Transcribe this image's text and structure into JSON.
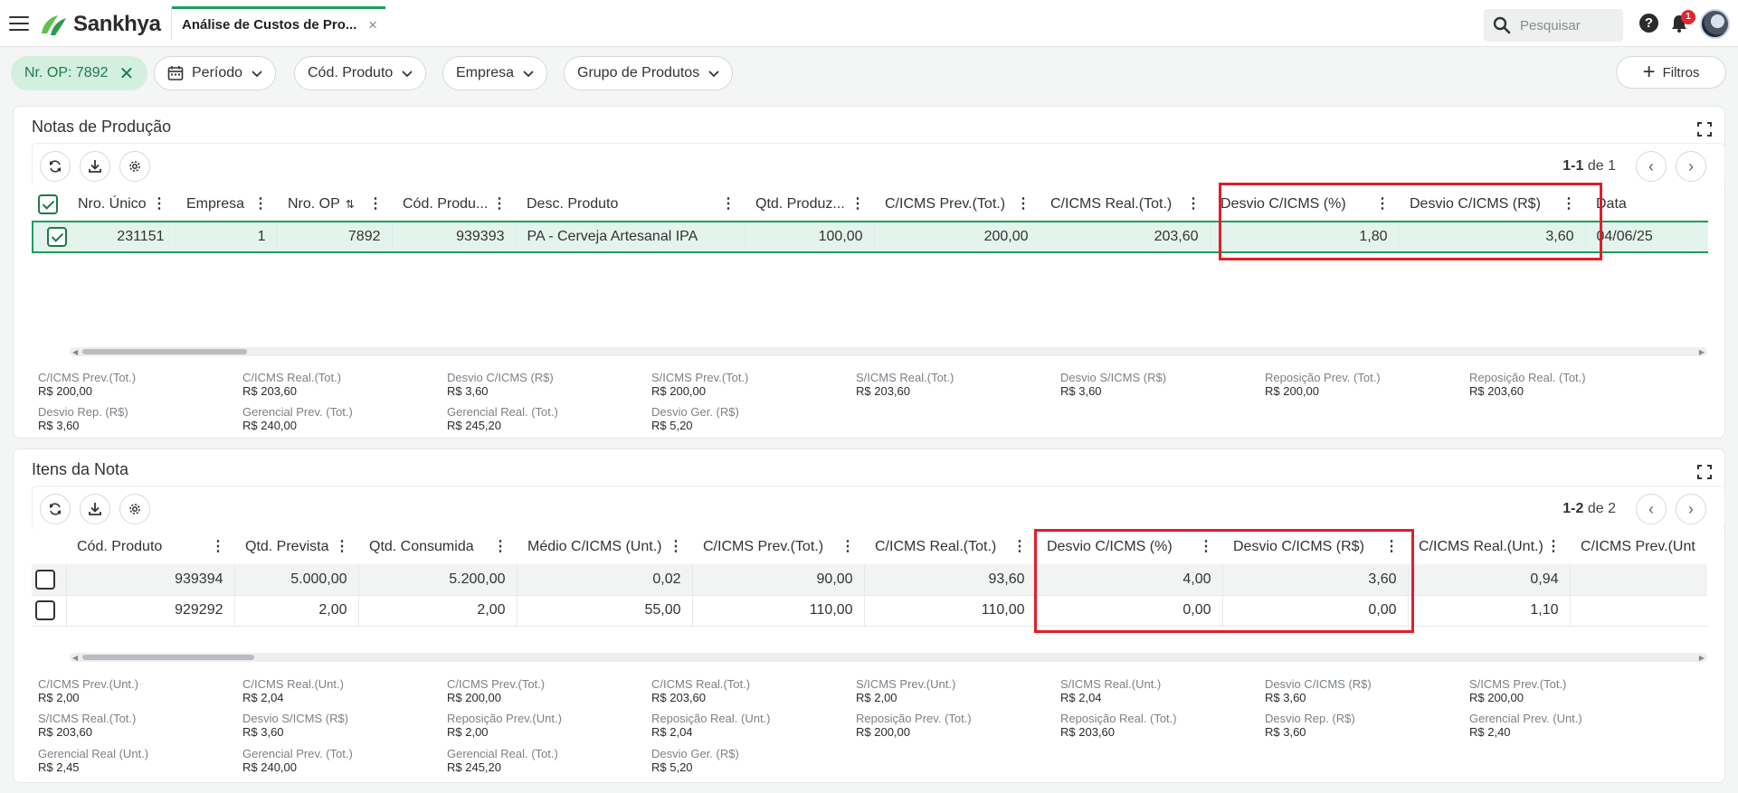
{
  "app": {
    "brand": "Sankhya",
    "tab_title": "Análise de Custos de Pro...",
    "tab_close": "×",
    "search_placeholder": "Pesquisar",
    "help": "?",
    "notifications_count": "1"
  },
  "filters": {
    "active_chip": "Nr. OP: 7892",
    "chips": [
      "Período",
      "Cód. Produto",
      "Empresa",
      "Grupo de Produtos"
    ],
    "more_filters": "Filtros"
  },
  "notas": {
    "title": "Notas de Produção",
    "pager": {
      "range": "1-1",
      "sep": "de",
      "total": "1"
    },
    "columns": [
      "Nro. Único",
      "Empresa",
      "Nro. OP",
      "Cód. Produ...",
      "Desc. Produto",
      "Qtd. Produz...",
      "C/ICMS Prev.(Tot.)",
      "C/ICMS Real.(Tot.)",
      "Desvio C/ICMS (%)",
      "Desvio C/ICMS (R$)",
      "Data"
    ],
    "rows": [
      [
        "231151",
        "1",
        "7892",
        "939393",
        "PA - Cerveja Artesanal IPA",
        "100,00",
        "200,00",
        "203,60",
        "1,80",
        "3,60",
        "04/06/25"
      ]
    ],
    "totals": [
      {
        "label": "C/ICMS Prev.(Tot.)",
        "value": "R$ 200,00"
      },
      {
        "label": "C/ICMS Real.(Tot.)",
        "value": "R$ 203,60"
      },
      {
        "label": "Desvio C/ICMS (R$)",
        "value": "R$ 3,60"
      },
      {
        "label": "S/ICMS Prev.(Tot.)",
        "value": "R$ 200,00"
      },
      {
        "label": "S/ICMS Real.(Tot.)",
        "value": "R$ 203,60"
      },
      {
        "label": "Desvio S/ICMS (R$)",
        "value": "R$ 3,60"
      },
      {
        "label": "Reposição Prev. (Tot.)",
        "value": "R$ 200,00"
      },
      {
        "label": "Reposição Real. (Tot.)",
        "value": "R$ 203,60"
      },
      {
        "label": "Desvio Rep. (R$)",
        "value": "R$ 3,60"
      },
      {
        "label": "Gerencial Prev. (Tot.)",
        "value": "R$ 240,00"
      },
      {
        "label": "Gerencial Real. (Tot.)",
        "value": "R$ 245,20"
      },
      {
        "label": "Desvio Ger. (R$)",
        "value": "R$ 5,20"
      }
    ]
  },
  "itens": {
    "title": "Itens da Nota",
    "pager": {
      "range": "1-2",
      "sep": "de",
      "total": "2"
    },
    "columns": [
      "Cód. Produto",
      "Qtd. Prevista",
      "Qtd. Consumida",
      "Médio C/ICMS (Unt.)",
      "C/ICMS Prev.(Tot.)",
      "C/ICMS Real.(Tot.)",
      "Desvio C/ICMS (%)",
      "Desvio C/ICMS (R$)",
      "C/ICMS Real.(Unt.)",
      "C/ICMS Prev.(Unt"
    ],
    "rows": [
      [
        "939394",
        "5.000,00",
        "5.200,00",
        "0,02",
        "90,00",
        "93,60",
        "4,00",
        "3,60",
        "0,94",
        ""
      ],
      [
        "929292",
        "2,00",
        "2,00",
        "55,00",
        "110,00",
        "110,00",
        "0,00",
        "0,00",
        "1,10",
        ""
      ]
    ],
    "totals": [
      {
        "label": "C/ICMS Prev.(Unt.)",
        "value": "R$ 2,00"
      },
      {
        "label": "C/ICMS Real.(Unt.)",
        "value": "R$ 2,04"
      },
      {
        "label": "C/ICMS Prev.(Tot.)",
        "value": "R$ 200,00"
      },
      {
        "label": "C/ICMS Real.(Tot.)",
        "value": "R$ 203,60"
      },
      {
        "label": "S/ICMS Prev.(Unt.)",
        "value": "R$ 2,00"
      },
      {
        "label": "S/ICMS Real.(Unt.)",
        "value": "R$ 2,04"
      },
      {
        "label": "Desvio C/ICMS (R$)",
        "value": "R$ 3,60"
      },
      {
        "label": "S/ICMS Prev.(Tot.)",
        "value": "R$ 200,00"
      },
      {
        "label": "S/ICMS Real.(Tot.)",
        "value": "R$ 203,60"
      },
      {
        "label": "Desvio S/ICMS (R$)",
        "value": "R$ 3,60"
      },
      {
        "label": "Reposição Prev.(Unt.)",
        "value": "R$ 2,00"
      },
      {
        "label": "Reposição Real. (Unt.)",
        "value": "R$ 2,04"
      },
      {
        "label": "Reposição Prev. (Tot.)",
        "value": "R$ 200,00"
      },
      {
        "label": "Reposição Real. (Tot.)",
        "value": "R$ 203,60"
      },
      {
        "label": "Desvio Rep. (R$)",
        "value": "R$ 3,60"
      },
      {
        "label": "Gerencial Prev. (Unt.)",
        "value": "R$ 2,40"
      },
      {
        "label": "Gerencial Real (Unt.)",
        "value": "R$ 2,45"
      },
      {
        "label": "Gerencial Prev. (Tot.)",
        "value": "R$ 240,00"
      },
      {
        "label": "Gerencial Real. (Tot.)",
        "value": "R$ 245,20"
      },
      {
        "label": "Desvio Ger. (R$)",
        "value": "R$ 5,20"
      }
    ]
  },
  "colors": {
    "accent": "#1e9e5e",
    "highlight": "#e01e2a",
    "selected_row": "#e3f4ec"
  }
}
